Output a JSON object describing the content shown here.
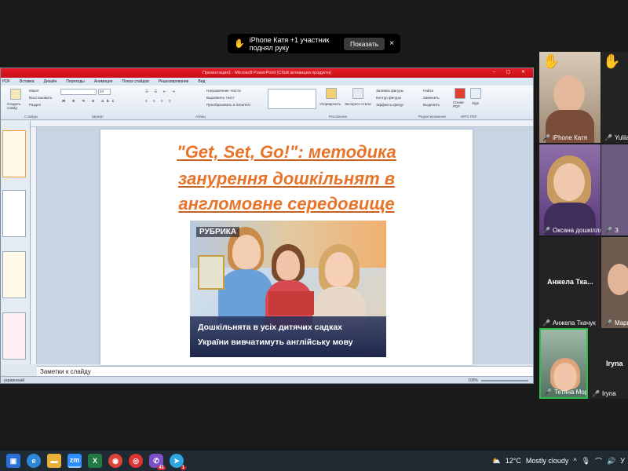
{
  "notification": {
    "text": "iPhone Катя +1 участник поднял руку",
    "show_label": "Показать",
    "close": "×"
  },
  "ppt": {
    "title": "Презентация1 - Microsoft PowerPoint (Сбой активации продукта)",
    "tabs": [
      "PDF",
      "Вставка",
      "Дизайн",
      "Переходы",
      "Анимация",
      "Показ слайдов",
      "Рецензирование",
      "Вид"
    ],
    "ribbon": {
      "create_slide": "Создать слайд",
      "layout": "Макет",
      "restore": "Восстановить",
      "section": "Раздел",
      "font_size": "24",
      "text_direction": "Направление текста",
      "align_text": "Выровнять текст",
      "smartart": "Преобразовать в SmartArt",
      "arrange": "Упорядочить",
      "quick_styles": "Экспресс-стили",
      "shape_fill": "Заливка фигуры",
      "shape_outline": "Контур фигуры",
      "shape_effects": "Эффекты фигур",
      "find": "Найти",
      "replace": "Заменить",
      "select": "Выделить",
      "create_pdf": "Create PDF",
      "sign": "Sign",
      "groups": {
        "slides": "Слайды",
        "font": "Шрифт",
        "paragraph": "Абзац",
        "drawing": "Рисование",
        "editing": "Редактирование",
        "wps_pdf": "WPS PDF"
      }
    },
    "slide": {
      "title_line1": "\"Get, Set, Go!\": методика",
      "title_line2": "занурення дошкільнят в",
      "title_line3": "англомовне середовище",
      "photo_logo": "РУБРИКА",
      "caption_line1": "Дошкільнята в усіх дитячих садках",
      "caption_line2": "України вивчатимуть англійську мову"
    },
    "notes_placeholder": "Заметки к слайду",
    "status": {
      "language": "украинский",
      "zoom": "100%"
    }
  },
  "participants": [
    {
      "name": "iPhone Катя",
      "raised": true
    },
    {
      "name": "Yuliia Z",
      "raised": true
    },
    {
      "name": "Оксана дошкілля ХОІ...",
      "raised": false
    },
    {
      "name": "Анжела Ткачук",
      "big": "Анжела Тка...",
      "raised": false
    },
    {
      "name": "Мари",
      "raised": false
    },
    {
      "name": "Тетяна Мороз",
      "raised": false
    },
    {
      "name": "Iryna",
      "big": "Iryna",
      "raised": false
    }
  ],
  "taskbar": {
    "weather": "12°C",
    "weather_text": "Mostly cloudy",
    "badge1": "41",
    "badge2": "1",
    "lang": "У"
  },
  "colors": {
    "title_orange": "#e8742a",
    "ppt_titlebar": "#e51c23",
    "zoom_bg": "#1a1a1a",
    "mic_red": "#e33"
  }
}
